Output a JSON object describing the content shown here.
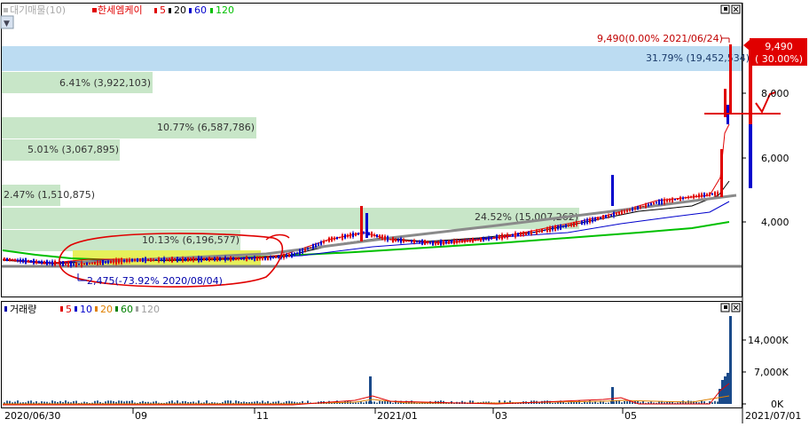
{
  "price_panel": {
    "legend_volume_ma": "대기매물(10)",
    "legend_name": "한세엠케이",
    "legend_ma": [
      {
        "label": "5",
        "color": "#e00000"
      },
      {
        "label": "20",
        "color": "#000000"
      },
      {
        "label": "60",
        "color": "#0000cc"
      },
      {
        "label": "120",
        "color": "#00c000"
      }
    ],
    "price_axis_ticks": [
      "8,000",
      "6,000",
      "4,000"
    ],
    "current_price_label": [
      "9,490",
      "( 30.00%)"
    ],
    "high_annotation": "9,490(0.00% 2021/06/24)",
    "low_annotation": "2,475(-73.92% 2020/08/04)"
  },
  "volume_panel": {
    "legend_title": "거래량",
    "legend_ma": [
      {
        "label": "5",
        "color": "#e00000"
      },
      {
        "label": "10",
        "color": "#0000cc"
      },
      {
        "label": "20",
        "color": "#e08000"
      },
      {
        "label": "60",
        "color": "#008000"
      },
      {
        "label": "120",
        "color": "#a0a0a0"
      }
    ],
    "axis_ticks": [
      "14,000K",
      "7,000K",
      "0K"
    ]
  },
  "x_axis": {
    "labels": [
      "2020/06/30",
      "09",
      "11",
      "2021/01",
      "03",
      "05",
      "2021/07/01"
    ]
  },
  "colors": {
    "up": "#e00000",
    "down": "#0000cc",
    "profile_blue": "#bcdcf2",
    "profile_green": "#c8e6c8",
    "highlight_yellow": "#e6f05a"
  },
  "chart_data": {
    "type": "candlestick",
    "x_range": [
      "2020/06/30",
      "2021/07/01"
    ],
    "price_ticks": [
      4000,
      6000,
      8000
    ],
    "current_price": 9490,
    "current_change_pct": 30.0,
    "high": {
      "price": 9490,
      "pct_from_current": 0.0,
      "date": "2021/06/24"
    },
    "low": {
      "price": 2475,
      "pct_from_current": -73.92,
      "date": "2020/08/04"
    },
    "volume_ticks_k": [
      0,
      7000,
      14000
    ],
    "volume_profile": [
      {
        "label": "31.79% (19,452,534)",
        "pct": 31.79,
        "volume": 19452534
      },
      {
        "label": "6.41% (3,922,103)",
        "pct": 6.41,
        "volume": 3922103
      },
      {
        "label": "10.77% (6,587,786)",
        "pct": 10.77,
        "volume": 6587786
      },
      {
        "label": "5.01% (3,067,895)",
        "pct": 5.01,
        "volume": 3067895
      },
      {
        "label": "2.47% (1,510,875)",
        "pct": 2.47,
        "volume": 1510875
      },
      {
        "label": "24.52% (15,007,262)",
        "pct": 24.52,
        "volume": 15007262
      },
      {
        "label": "10.13% (6,196,577)",
        "pct": 10.13,
        "volume": 6196577
      }
    ]
  }
}
